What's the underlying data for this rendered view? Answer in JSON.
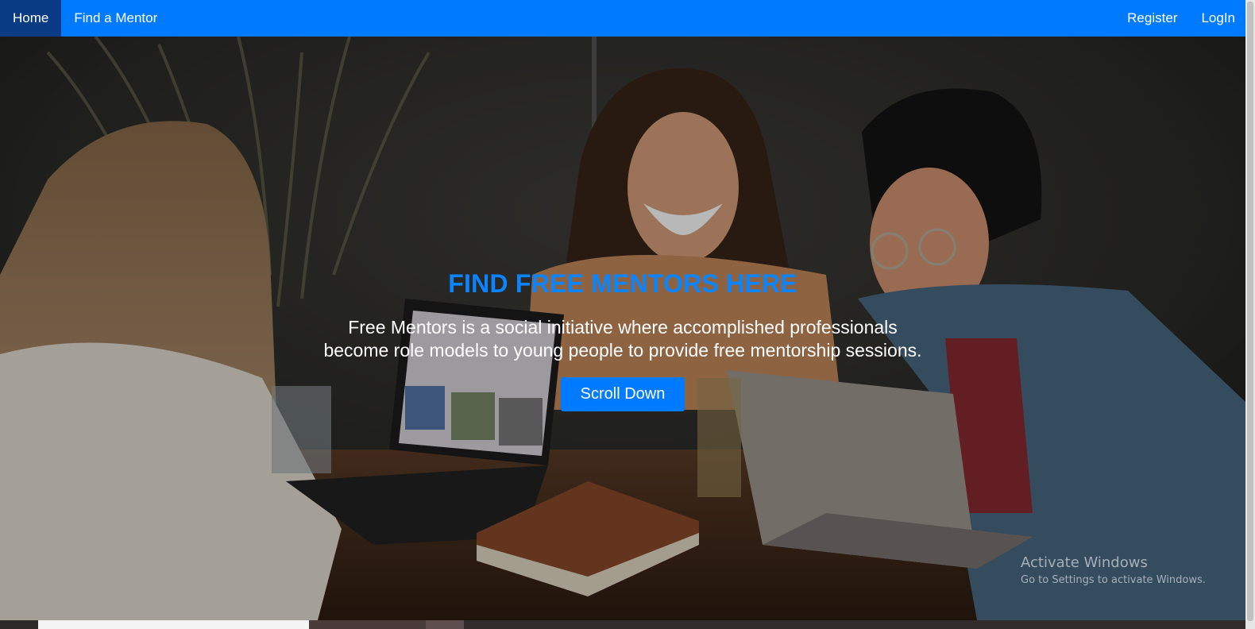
{
  "navbar": {
    "left_items": [
      {
        "label": "Home",
        "active": true
      },
      {
        "label": "Find a Mentor",
        "active": false
      }
    ],
    "right_items": [
      {
        "label": "Register"
      },
      {
        "label": "LogIn"
      }
    ],
    "background": "#007bff",
    "active_background": "#0a3b85"
  },
  "hero": {
    "title": "FIND FREE MENTORS HERE",
    "description": "Free Mentors is a social initiative where accomplished professionals become role models to young people to provide free mentorship sessions.",
    "button_label": "Scroll Down",
    "title_color": "#0a84ff",
    "button_color": "#007bff"
  },
  "watermark": {
    "title": "Activate Windows",
    "subtitle": "Go to Settings to activate Windows."
  }
}
